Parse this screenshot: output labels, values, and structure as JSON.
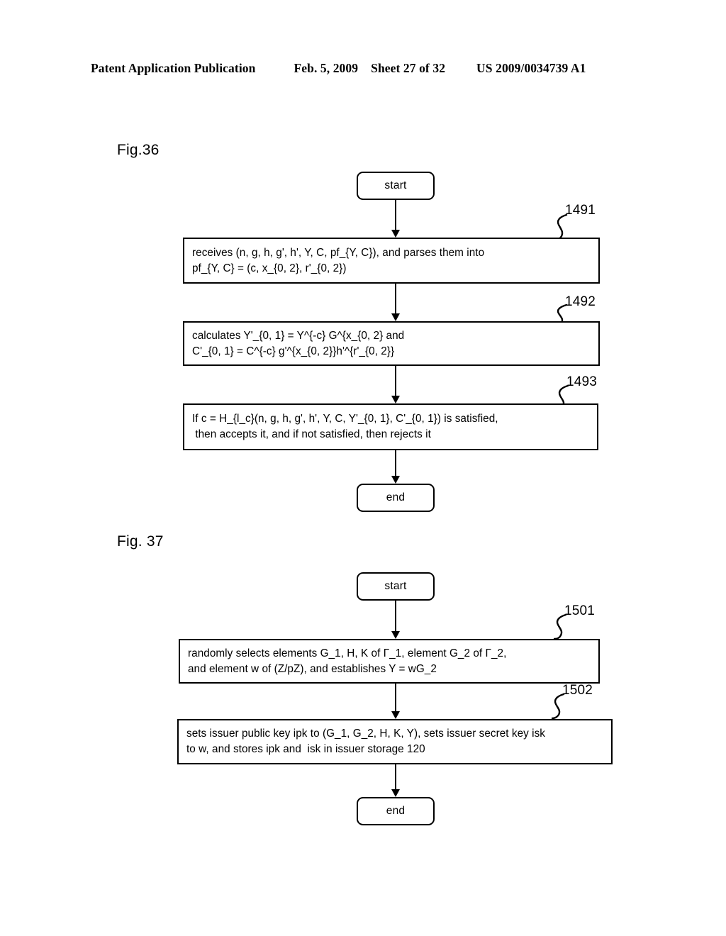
{
  "header": {
    "publication": "Patent Application Publication",
    "date": "Feb. 5, 2009",
    "sheet": "Sheet 27 of 32",
    "patent_number": "US 2009/0034739 A1"
  },
  "figures": [
    {
      "label": "Fig.36",
      "start_label": "start",
      "end_label": "end",
      "steps": [
        {
          "ref": "1491",
          "text": "receives (n, g, h, g', h', Y, C, pf_{Y, C}), and parses them into\npf_{Y, C} = (c, x_{0, 2}, r'_{0, 2})"
        },
        {
          "ref": "1492",
          "text": "calculates Y'_{0, 1} = Y^{-c} G^{x_{0, 2} and\nC'_{0, 1} = C^{-c} g'^{x_{0, 2}}h'^{r'_{0, 2}}"
        },
        {
          "ref": "1493",
          "text": "If c = H_{l_c}(n, g, h, g', h', Y, C, Y'_{0, 1}, C'_{0, 1}) is satisfied,\n then accepts it, and if not satisfied, then rejects it"
        }
      ]
    },
    {
      "label": "Fig. 37",
      "start_label": "start",
      "end_label": "end",
      "steps": [
        {
          "ref": "1501",
          "text": "randomly selects elements G_1, H, K of Γ_1, element G_2 of Γ_2,\nand element w of (Z/pZ), and establishes Y = wG_2"
        },
        {
          "ref": "1502",
          "text": "sets issuer public key ipk to (G_1, G_2, H, K, Y), sets issuer secret key isk\nto w, and stores ipk and  isk in issuer storage 120"
        }
      ]
    }
  ]
}
